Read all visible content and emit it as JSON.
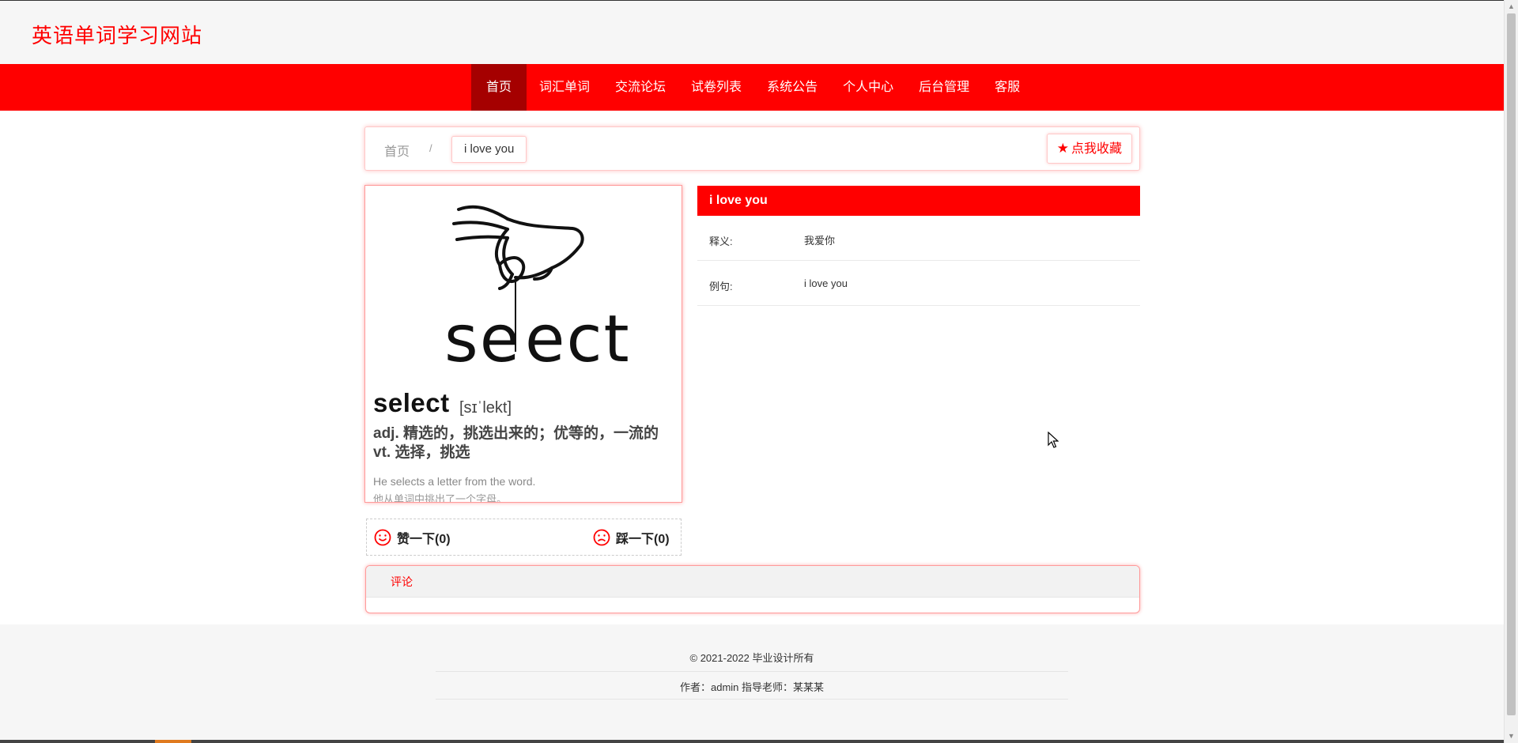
{
  "site": {
    "title": "英语单词学习网站"
  },
  "nav": {
    "items": [
      {
        "label": "首页"
      },
      {
        "label": "词汇单词"
      },
      {
        "label": "交流论坛"
      },
      {
        "label": "试卷列表"
      },
      {
        "label": "系统公告"
      },
      {
        "label": "个人中心"
      },
      {
        "label": "后台管理"
      },
      {
        "label": "客服"
      }
    ],
    "active_index": 0
  },
  "breadcrumb": {
    "home": "首页",
    "separator": "/",
    "current": "i love you"
  },
  "favorite_button": {
    "icon": "star-icon",
    "label": "点我收藏"
  },
  "word_image": {
    "word": "select",
    "phonetic": "[sɪˈlekt]",
    "definition_line1": "adj. 精选的，挑选出来的；优等的，一流的",
    "definition_line2": "vt. 选择，挑选",
    "example_en": "He selects a letter from the word.",
    "example_cn": "他从单词中挑出了一个字母。"
  },
  "votes": {
    "like_label": "赞一下(0)",
    "dislike_label": "踩一下(0)"
  },
  "detail": {
    "title": "i love you",
    "rows": [
      {
        "label": "释义:",
        "value": "我爱你"
      },
      {
        "label": "例句:",
        "value": "i love you"
      }
    ]
  },
  "comments": {
    "title": "评论"
  },
  "footer": {
    "copyright": "© 2021-2022 毕业设计所有",
    "credits": "作者：admin 指导老师：某某某"
  },
  "colors": {
    "accent": "#ff0000",
    "nav_active": "#a50000",
    "header_bg": "#f6f6f6"
  }
}
